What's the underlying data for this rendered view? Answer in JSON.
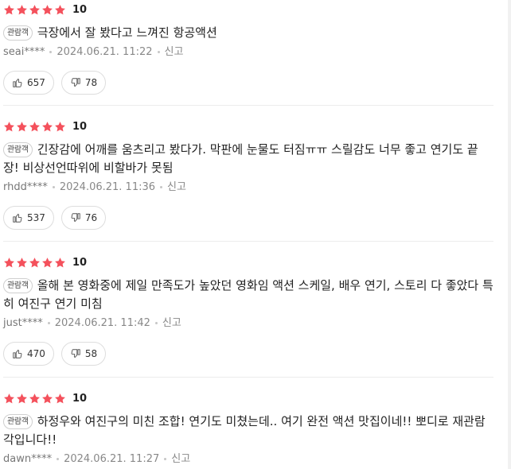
{
  "colors": {
    "star": "#f4515c",
    "badge_border": "#cfcfcf",
    "meta_text": "#888888",
    "divider": "#ececec"
  },
  "icons": {
    "star": "star-icon",
    "like": "thumbs-up-icon",
    "dislike": "thumbs-down-icon"
  },
  "reviews": [
    {
      "stars": 5,
      "score": "10",
      "badge": "관람객",
      "text": "극장에서 잘 봤다고 느껴진 항공액션",
      "user": "seai****",
      "date": "2024.06.21. 11:22",
      "report": "신고",
      "likes": "657",
      "dislikes": "78"
    },
    {
      "stars": 5,
      "score": "10",
      "badge": "관람객",
      "text": "긴장감에 어깨를 움츠리고 봤다가. 막판에 눈물도 터짐ㅠㅠ 스릴감도 너무 좋고 연기도 끝장! 비상선언따위에 비할바가 못됨",
      "user": "rhdd****",
      "date": "2024.06.21. 11:36",
      "report": "신고",
      "likes": "537",
      "dislikes": "76"
    },
    {
      "stars": 5,
      "score": "10",
      "badge": "관람객",
      "text": "올해 본 영화중에 제일 만족도가 높았던 영화임 액션 스케일, 배우 연기, 스토리 다 좋았다 특히 여진구 연기 미침",
      "user": "just****",
      "date": "2024.06.21. 11:42",
      "report": "신고",
      "likes": "470",
      "dislikes": "58"
    },
    {
      "stars": 5,
      "score": "10",
      "badge": "관람객",
      "text": "하정우와 여진구의 미친 조합! 연기도 미쳤는데.. 여기 완전 액션 맛집이네!! 뽀디로 재관람 각입니다!!",
      "user": "dawn****",
      "date": "2024.06.21. 11:27",
      "report": "신고",
      "likes": "",
      "dislikes": ""
    }
  ]
}
